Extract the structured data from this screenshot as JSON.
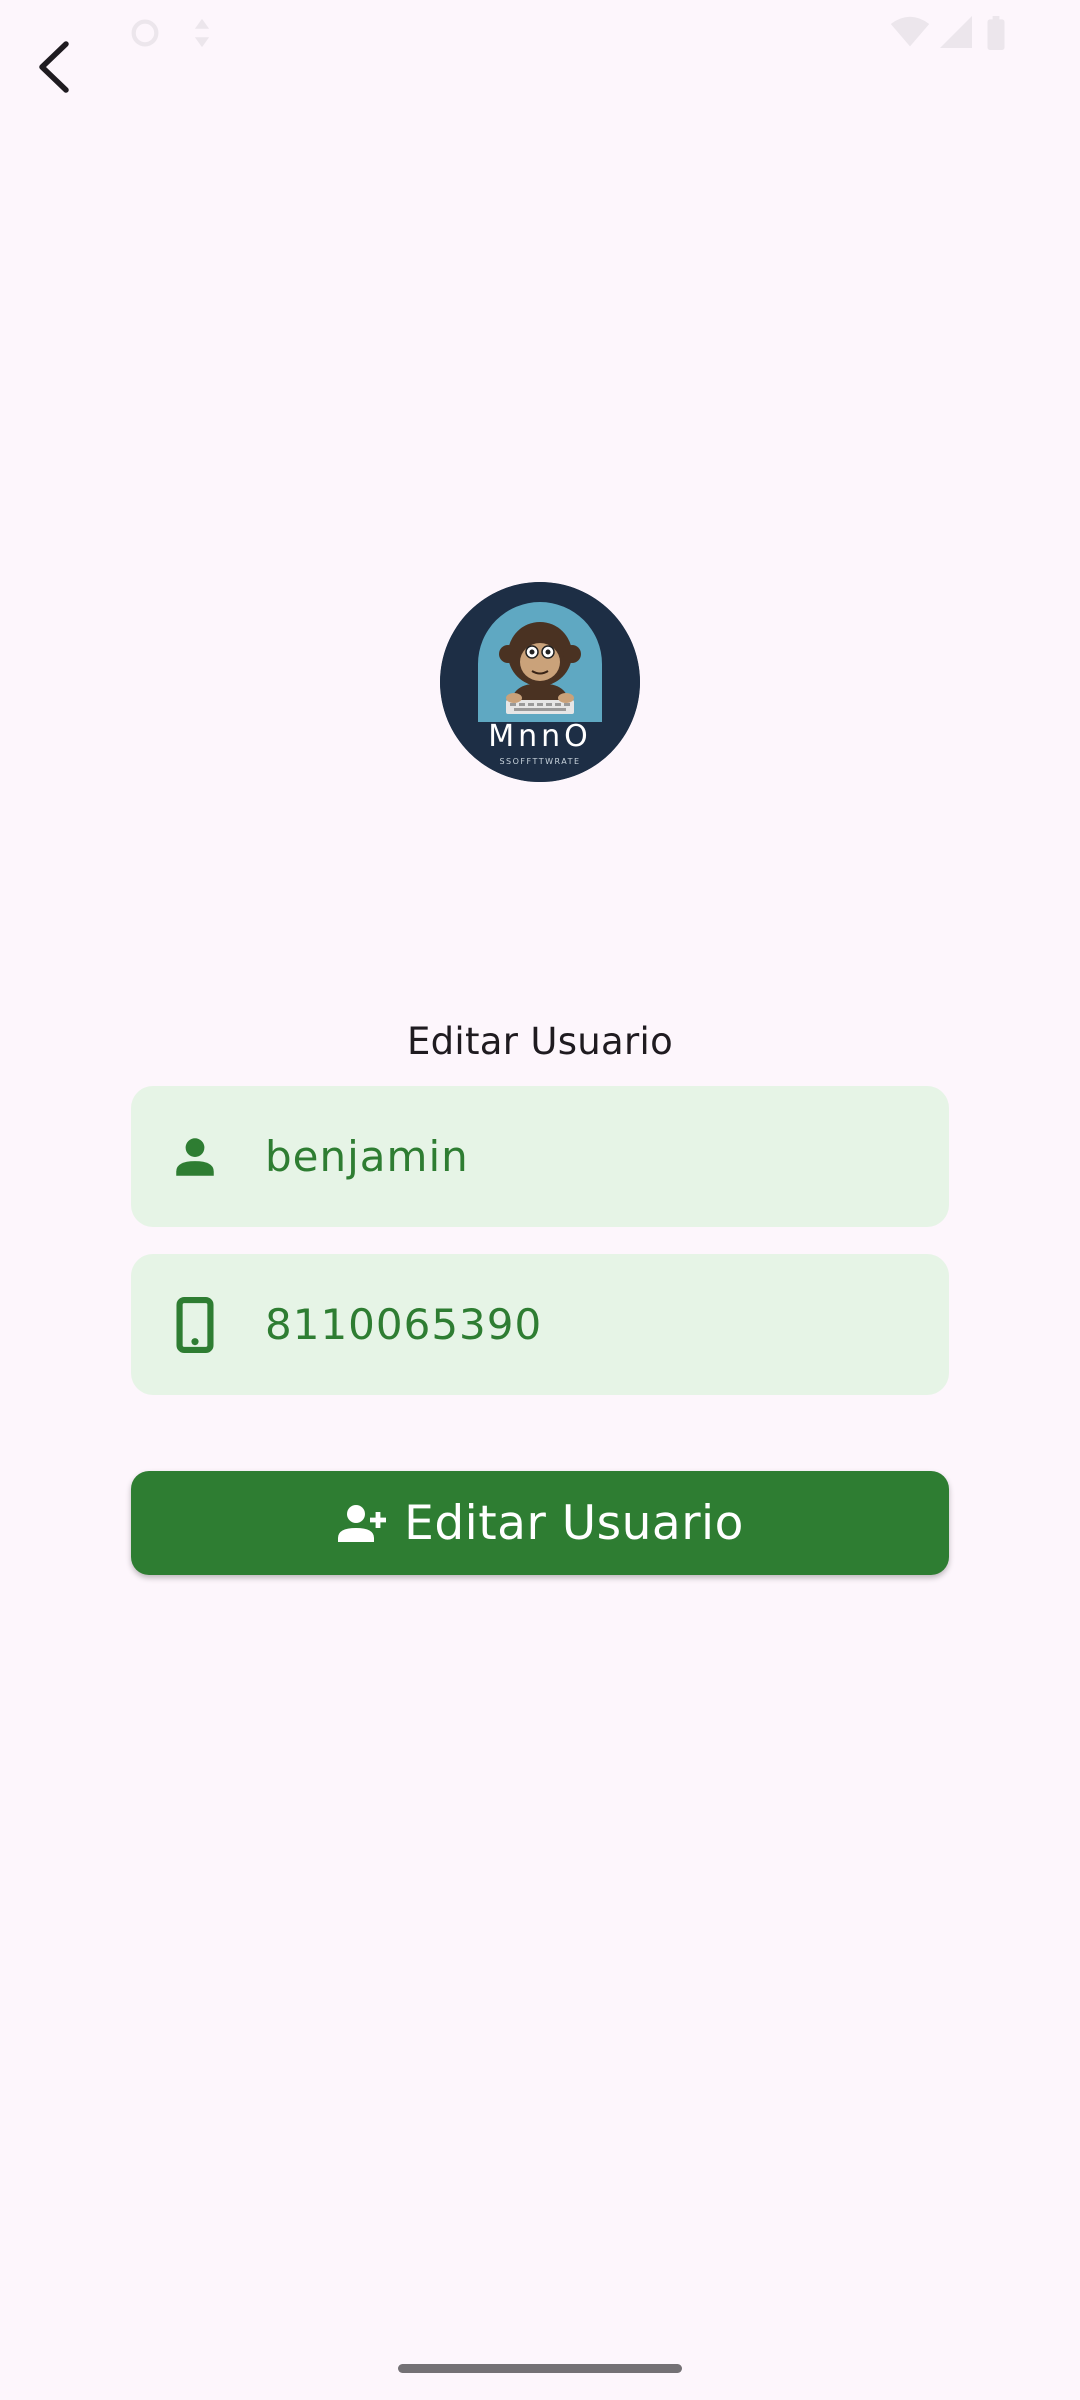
{
  "header": {
    "back_icon": "arrow-back-icon"
  },
  "logo": {
    "icon": "monkey-logo",
    "wordmark": "MnnO",
    "tagline": "SSOFFTTWRATE"
  },
  "form": {
    "title": "Editar Usuario",
    "name_field": {
      "icon": "person-icon",
      "value": "benjamin"
    },
    "phone_field": {
      "icon": "smartphone-icon",
      "value": "8110065390"
    },
    "submit_button": {
      "icon": "person-add-icon",
      "label": "Editar Usuario"
    }
  },
  "colors": {
    "background": "#fdf6fc",
    "accent": "#2e7d32",
    "field_background": "#e6f4e6",
    "logo_background": "#1d2e45"
  }
}
